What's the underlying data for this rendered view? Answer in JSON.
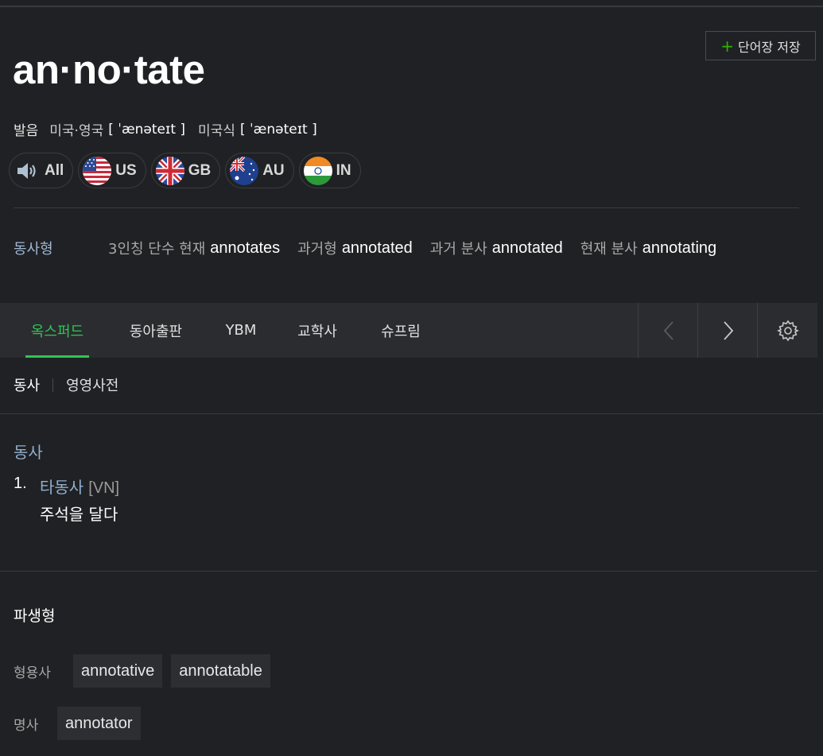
{
  "entry": {
    "headword": "an·no·tate",
    "save_button": {
      "plus": "+",
      "label": "단어장 저장"
    }
  },
  "pronunciation": {
    "label": "발음",
    "items": [
      {
        "region": "미국·영국",
        "ipa": "[ ˈænəteɪt ]"
      },
      {
        "region": "미국식",
        "ipa": "[ ˈænəteɪt ]"
      }
    ],
    "audio_buttons": [
      {
        "label": "All",
        "icon": "speaker-icon"
      },
      {
        "label": "US",
        "icon": "us-flag-icon"
      },
      {
        "label": "GB",
        "icon": "gb-flag-icon"
      },
      {
        "label": "AU",
        "icon": "au-flag-icon"
      },
      {
        "label": "IN",
        "icon": "in-flag-icon"
      }
    ]
  },
  "verb_forms": {
    "label": "동사형",
    "forms": [
      {
        "label": "3인칭 단수 현재",
        "value": "annotates"
      },
      {
        "label": "과거형",
        "value": "annotated"
      },
      {
        "label": "과거 분사",
        "value": "annotated"
      },
      {
        "label": "현재 분사",
        "value": "annotating"
      }
    ]
  },
  "dict_tabs": {
    "tabs": [
      "옥스퍼드",
      "동아출판",
      "YBM",
      "교학사",
      "슈프림"
    ],
    "active": "옥스퍼드",
    "nav_icons": [
      "chevron-left-icon",
      "chevron-right-icon",
      "gear-icon"
    ]
  },
  "sub_tabs": [
    "동사",
    "영영사전"
  ],
  "definition": {
    "pos": "동사",
    "senses": [
      {
        "num": "1.",
        "type": "타동사",
        "pattern": "[VN]",
        "meaning": "주석을 달다"
      }
    ]
  },
  "derivatives": {
    "title": "파생형",
    "groups": [
      {
        "label": "형용사",
        "words": [
          "annotative",
          "annotatable"
        ]
      },
      {
        "label": "명사",
        "words": [
          "annotator"
        ]
      }
    ]
  },
  "colors": {
    "background": "#202124",
    "accent_green": "#2dc653",
    "link_blue": "#8fb0d0"
  }
}
